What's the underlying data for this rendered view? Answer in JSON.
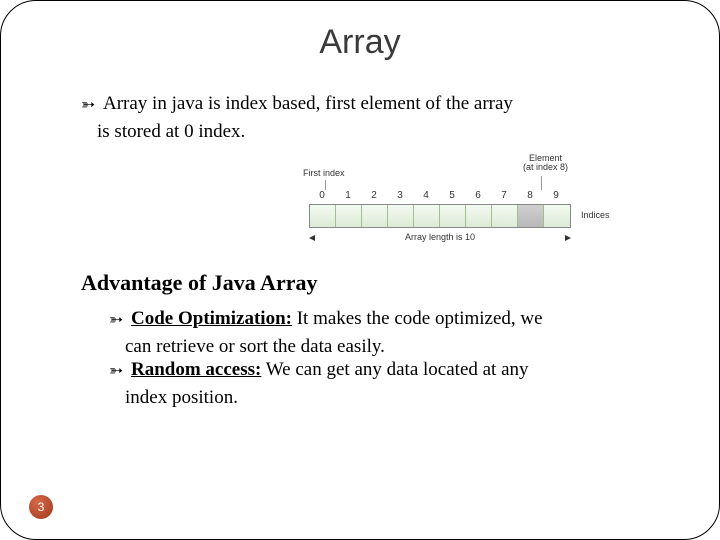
{
  "title": "Array",
  "bullet1_a": "Array in java is index based, first element of the array",
  "bullet1_b": "is stored at 0 index.",
  "diagram": {
    "first_index_label": "First index",
    "element_label_l1": "Element",
    "element_label_l2": "(at index 8)",
    "indices": [
      "0",
      "1",
      "2",
      "3",
      "4",
      "5",
      "6",
      "7",
      "8",
      "9"
    ],
    "indices_caption": "Indices",
    "length_label": "Array length is 10"
  },
  "section_heading": "Advantage of Java Array",
  "adv1_head": "Code Optimization:",
  "adv1_tail_a": " It makes the code optimized, we",
  "adv1_tail_b": "can retrieve or sort the data easily.",
  "adv2_head": "Random access:",
  "adv2_tail_a": " We can get any data located at any",
  "adv2_tail_b": "index position.",
  "page_number": "3",
  "chart_data": {
    "type": "table",
    "title": "Java array index illustration",
    "categories": [
      "0",
      "1",
      "2",
      "3",
      "4",
      "5",
      "6",
      "7",
      "8",
      "9"
    ],
    "values": [
      null,
      null,
      null,
      null,
      null,
      null,
      null,
      null,
      null,
      null
    ],
    "highlighted_index": 8,
    "length": 10,
    "xlabel": "Indices",
    "ylabel": ""
  }
}
